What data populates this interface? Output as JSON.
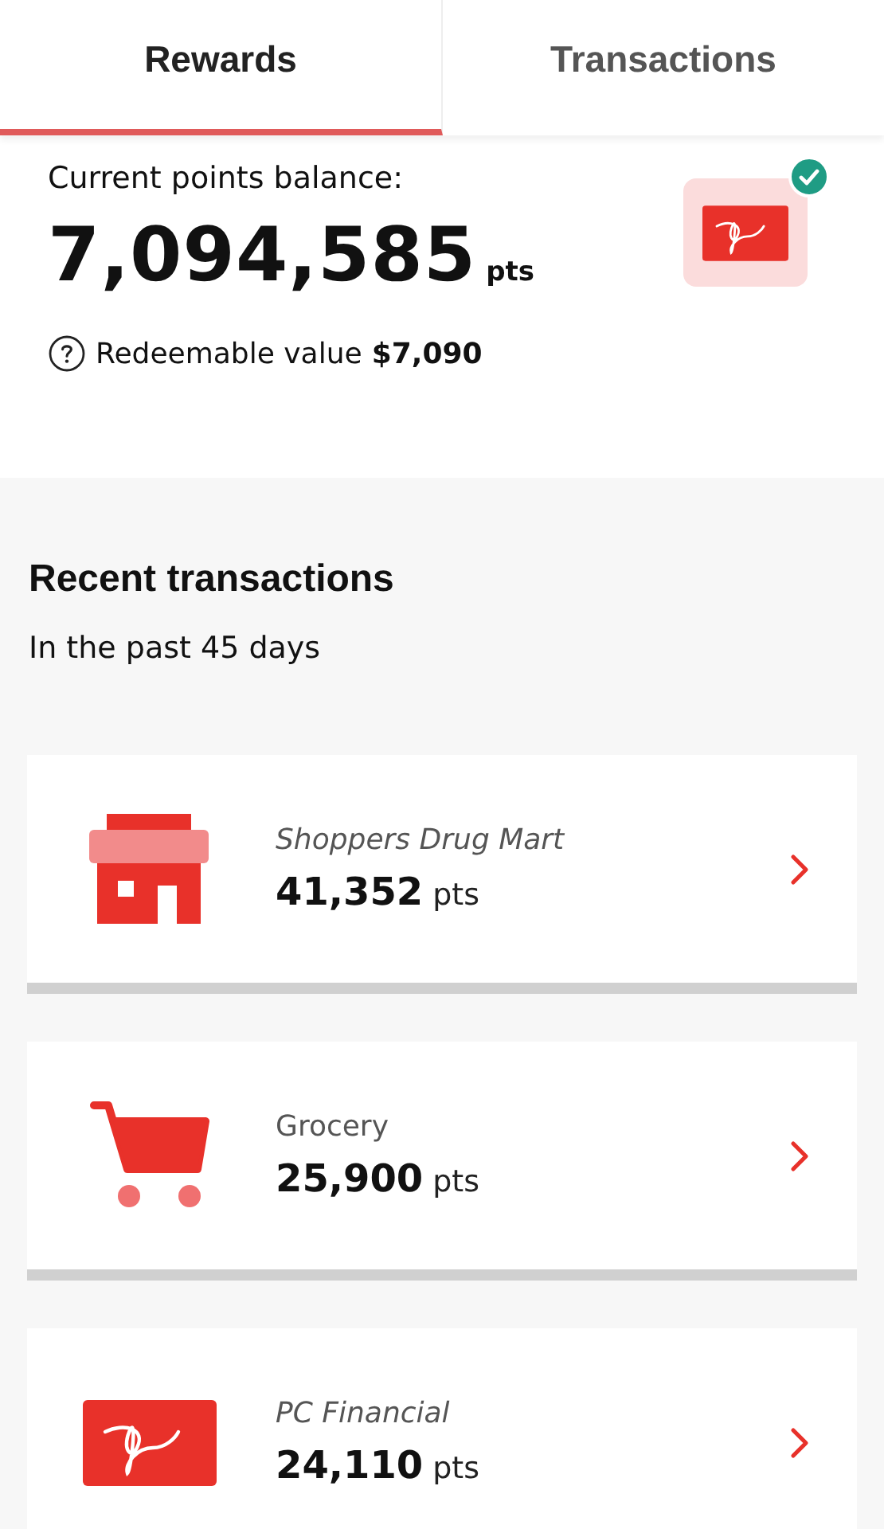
{
  "tabs": [
    {
      "label": "Rewards",
      "selected": true
    },
    {
      "label": "Transactions",
      "selected": false
    }
  ],
  "balance": {
    "label": "Current points balance:",
    "points": "7,094,585",
    "unit": "pts",
    "card_verified": true,
    "redeemable_label": "Redeemable value",
    "redeemable_value": "$7,090"
  },
  "recent": {
    "title": "Recent transactions",
    "subtitle": "In the past 45 days",
    "items": [
      {
        "kind": "store",
        "name": "Shoppers Drug Mart",
        "points": "41,352",
        "unit": "pts"
      },
      {
        "kind": "cart",
        "name": "Grocery",
        "points": "25,900",
        "unit": "pts"
      },
      {
        "kind": "card",
        "name": "PC Financial",
        "points": "24,110",
        "unit": "pts"
      }
    ]
  }
}
